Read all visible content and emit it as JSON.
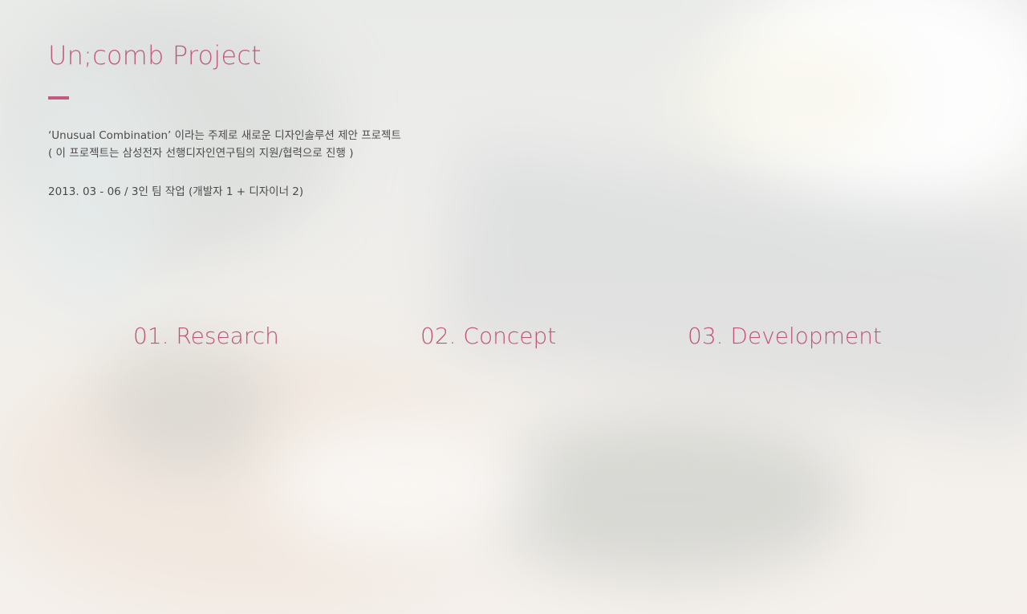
{
  "header": {
    "title": "Un;comb Project"
  },
  "description": {
    "line1": "‘Unusual Combination’ 이라는 주제로 새로운 디자인솔루션 제안 프로젝트",
    "line2": "( 이 프로젝트는 삼성전자 선행디자인연구팀의 지원/협력으로 진행 )"
  },
  "meta": {
    "period": "2013. 03 - 06 / 3인 팀 작업 (개발자 1 + 디자이너 2)"
  },
  "sections": [
    {
      "label": "01. Research"
    },
    {
      "label": "02. Concept"
    },
    {
      "label": "03. Development"
    }
  ],
  "colors": {
    "accent": "#c05a80",
    "text": "#4e4a4b"
  }
}
